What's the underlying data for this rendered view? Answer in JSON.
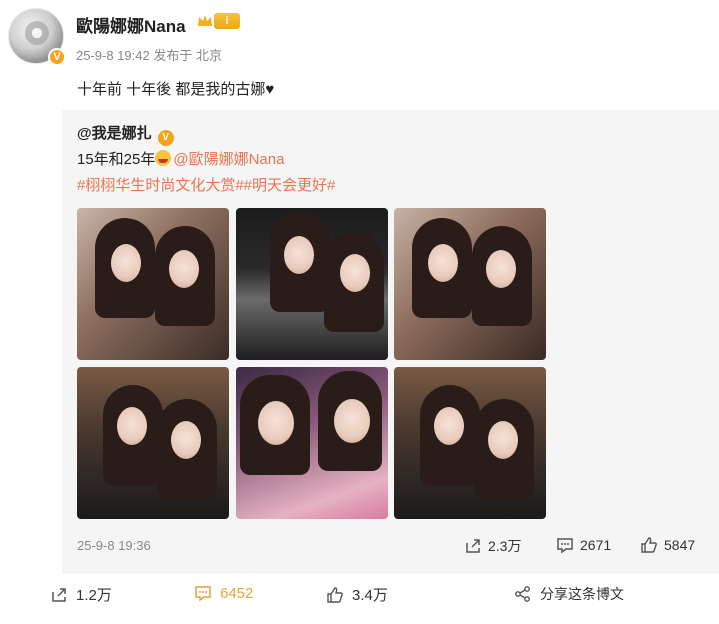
{
  "post": {
    "username": "歐陽娜娜Nana",
    "vip_badge": "i",
    "meta": "25-9-8 19:42  发布于 北京",
    "text": "十年前 十年後 都是我的古娜♥"
  },
  "repost": {
    "user": "@我是娜扎",
    "text_prefix": "15年和25年",
    "mention": "@歐陽娜娜Nana",
    "hashtags": "#栩栩华生时尚文化大赏##明天会更好#",
    "time": "25-9-8 19:36",
    "stats": {
      "forward": "2.3万",
      "comment": "2671",
      "like": "5847"
    }
  },
  "actions": {
    "forward": "1.2万",
    "comment": "6452",
    "like": "3.4万",
    "share": "分享这条博文"
  },
  "colors": {
    "accent": "#eb7350",
    "verified": "#f7a21b",
    "comment_highlight": "#e6a23c"
  }
}
